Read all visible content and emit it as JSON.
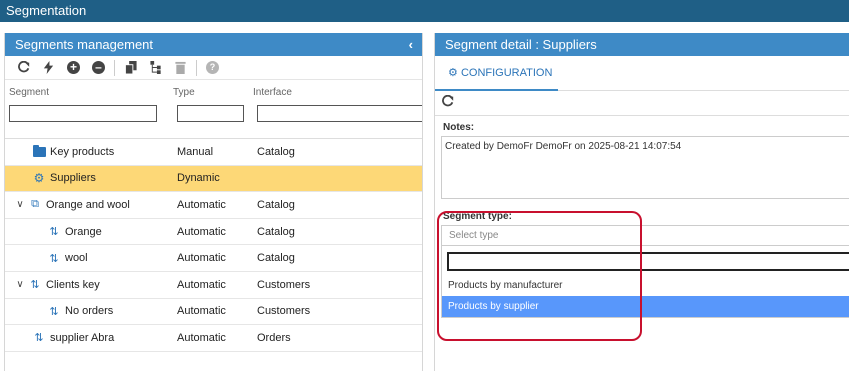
{
  "app": {
    "title": "Segmentation"
  },
  "left": {
    "title": "Segments management",
    "collapse_icon": "chevron-left-icon",
    "toolbar": [
      "refresh-icon",
      "bolt-icon",
      "add-circle-icon",
      "remove-circle-icon",
      "copy-icon",
      "tree-icon",
      "trash-icon",
      "help-icon"
    ],
    "help_glyph": "?",
    "columns": {
      "segment": "Segment",
      "type": "Type",
      "interface": "Interface"
    },
    "rows": [
      {
        "name": "Key products",
        "type": "Manual",
        "interface": "Catalog",
        "icon": "folder-icon"
      },
      {
        "name": "Suppliers",
        "type": "Dynamic",
        "interface": "",
        "icon": "dynamic-gear-icon"
      },
      {
        "name": "Orange and wool",
        "type": "Automatic",
        "interface": "Catalog",
        "icon": "copy-icon"
      },
      {
        "name": "Orange",
        "type": "Automatic",
        "interface": "Catalog",
        "icon": "sync-icon"
      },
      {
        "name": "wool",
        "type": "Automatic",
        "interface": "Catalog",
        "icon": "sync-icon"
      },
      {
        "name": "Clients key",
        "type": "Automatic",
        "interface": "Customers",
        "icon": "sync-icon"
      },
      {
        "name": "No orders",
        "type": "Automatic",
        "interface": "Customers",
        "icon": "sync-icon"
      },
      {
        "name": "supplier Abra",
        "type": "Automatic",
        "interface": "Orders",
        "icon": "sync-icon"
      }
    ]
  },
  "right": {
    "title": "Segment detail : Suppliers",
    "tab": "CONFIGURATION",
    "notes_label": "Notes:",
    "notes_value": "Created by DemoFr DemoFr on 2025-08-21 14:07:54",
    "segment_type_label": "Segment type:",
    "select_placeholder": "Select type",
    "options": [
      "Products by manufacturer",
      "Products by supplier"
    ],
    "highlighted_option": "Products by supplier"
  },
  "colors": {
    "topbar": "#1f5f86",
    "panel_header": "#3e8ac6",
    "selected_row": "#fdd877",
    "highlight": "#5897fb",
    "annotation": "#c8102e"
  }
}
